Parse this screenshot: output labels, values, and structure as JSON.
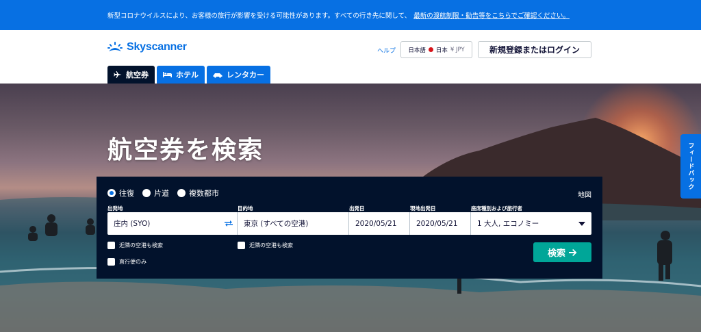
{
  "banner": {
    "text": "新型コロナウイルスにより、お客様の旅行が影響を受ける可能性があります。すべての行き先に関して、",
    "link": "最新の渡航制限・勧告等をこちらでご確認ください。"
  },
  "header": {
    "logo": "Skyscanner",
    "help": "ヘルプ",
    "locale": {
      "language": "日本語",
      "country": "日本",
      "currency": "¥ JPY"
    },
    "login": "新規登録またはログイン"
  },
  "tabs": [
    {
      "label": "航空券",
      "icon": "plane-icon"
    },
    {
      "label": "ホテル",
      "icon": "bed-icon"
    },
    {
      "label": "レンタカー",
      "icon": "car-icon"
    }
  ],
  "hero": {
    "title": "航空券を検索"
  },
  "search": {
    "trip_types": [
      "往復",
      "片道",
      "複数都市"
    ],
    "selected_trip": "往復",
    "map": "地図",
    "labels": {
      "from": "出発地",
      "to": "目的地",
      "depart": "出発日",
      "return": "現地出発日",
      "cabin": "座席種別および旅行者"
    },
    "values": {
      "from": "庄内 (SYO)",
      "to": "東京 (すべての空港)",
      "depart": "2020/05/21",
      "return": "2020/05/21",
      "cabin": "1 大人, エコノミー"
    },
    "nearby_from": "近隣の空港も検索",
    "nearby_to": "近隣の空港も検索",
    "direct_only": "直行便のみ",
    "submit": "検索"
  },
  "feedback": "フィードバック",
  "colors": {
    "brand": "#0770e3",
    "panel": "#02122c",
    "search_button": "#00a698"
  }
}
